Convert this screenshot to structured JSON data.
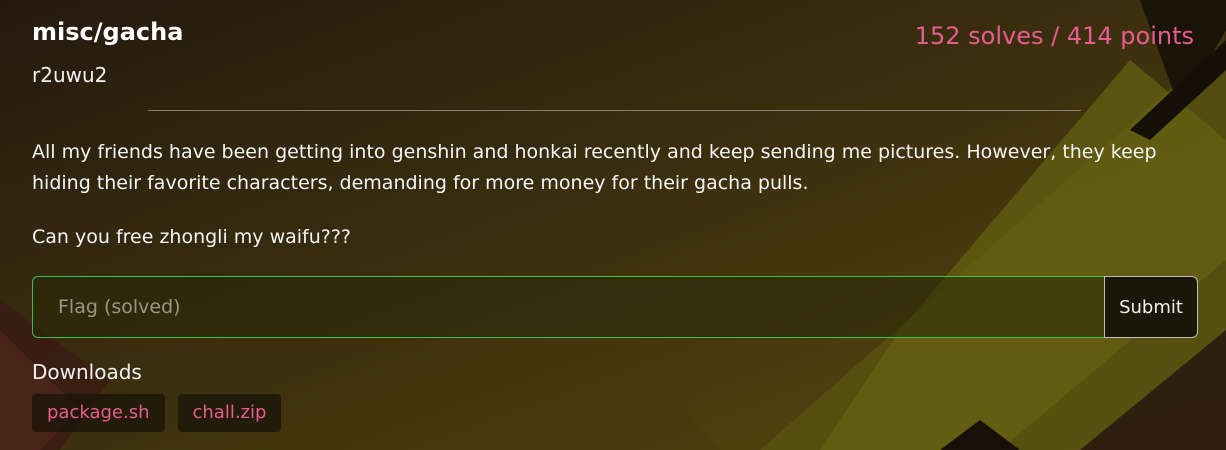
{
  "challenge": {
    "title": "misc/gacha",
    "author": "r2uwu2",
    "stats": "152 solves / 414 points",
    "description": [
      "All my friends have been getting into genshin and honkai recently and keep sending me pictures. However, they keep hiding their favorite characters, demanding for more money for their gacha pulls.",
      "Can you free zhongli my waifu???"
    ]
  },
  "flag": {
    "placeholder": "Flag (solved)",
    "value": "",
    "submit_label": "Submit"
  },
  "downloads": {
    "label": "Downloads",
    "files": [
      "package.sh",
      "chall.zip"
    ]
  },
  "colors": {
    "accent": "#e85c8f",
    "input_border": "#3fc04a"
  }
}
